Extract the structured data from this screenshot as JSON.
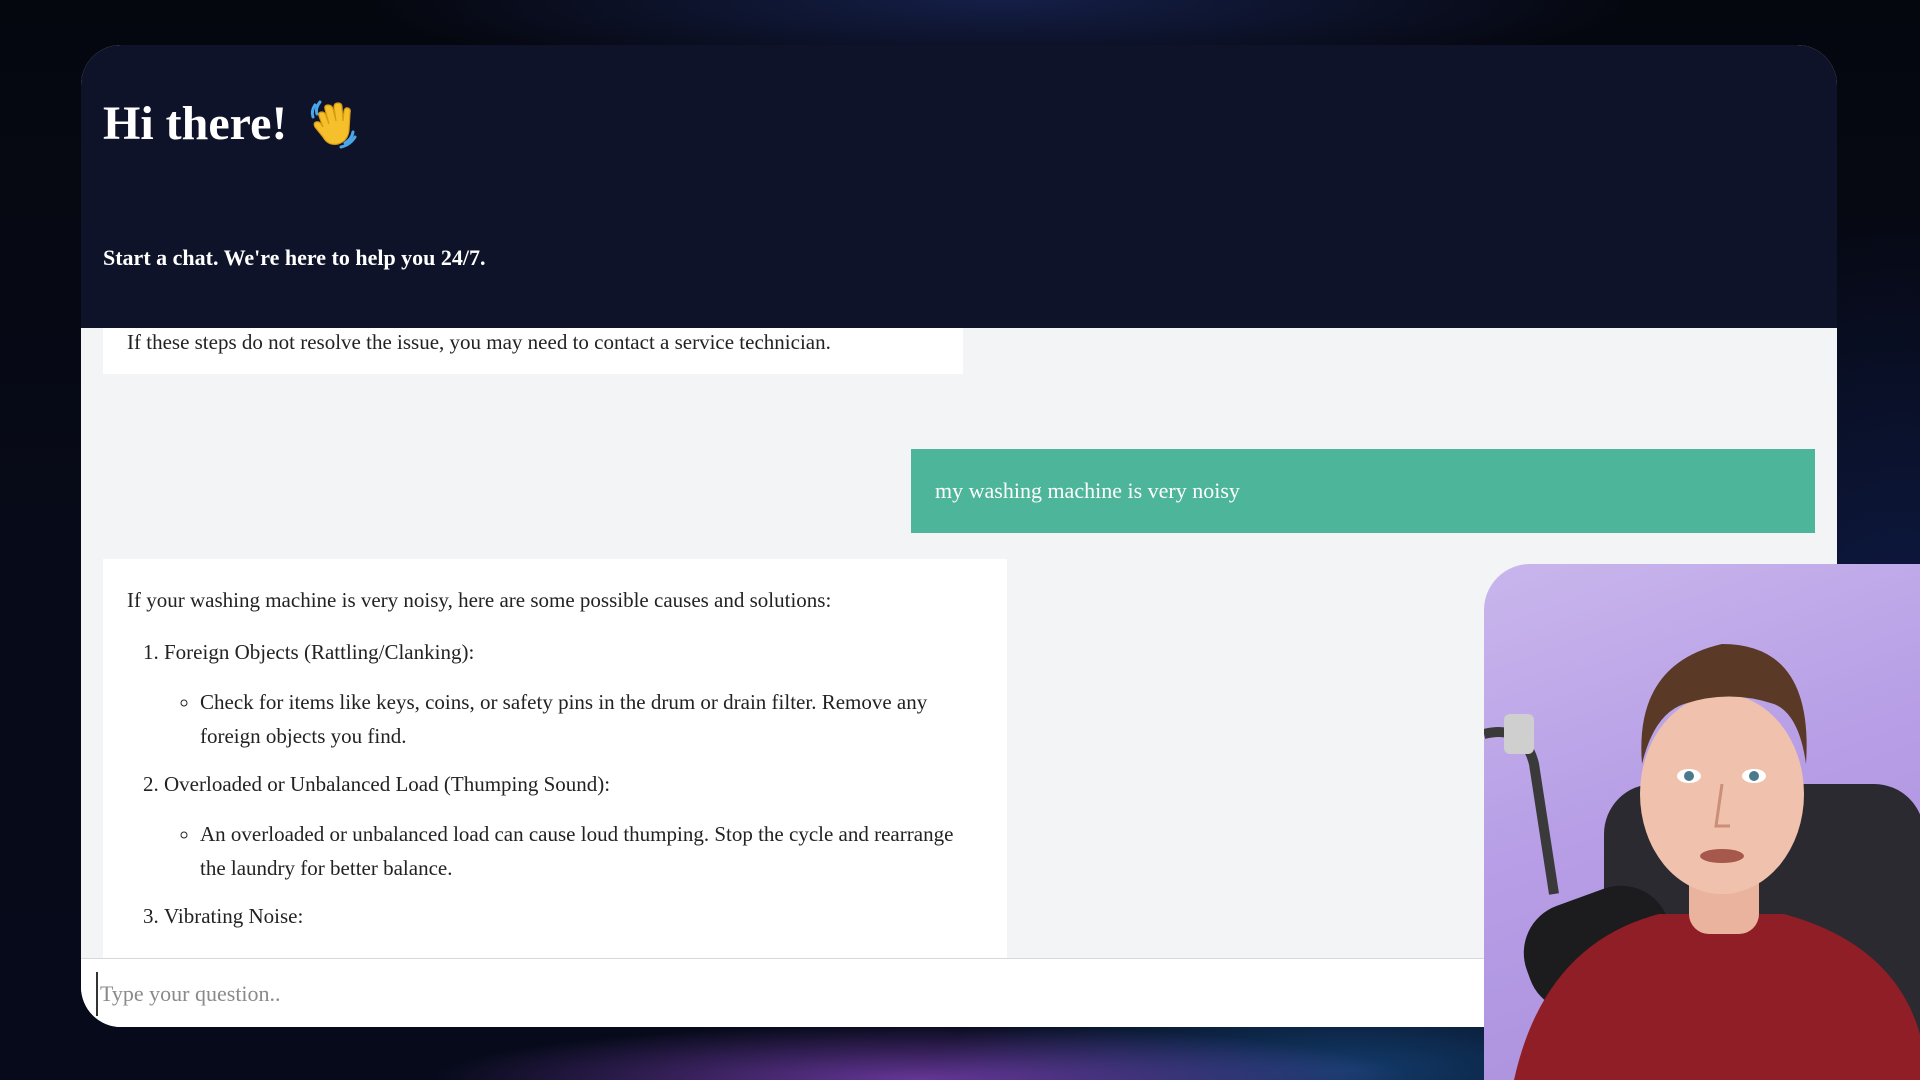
{
  "header": {
    "title": "Hi there!",
    "subtitle": "Start a chat. We're here to help you 24/7."
  },
  "messages": {
    "previous_bot_tail": "If these steps do not resolve the issue, you may need to contact a service technician.",
    "user_message": "my washing machine is very noisy",
    "bot_reply": {
      "intro": "If your washing machine is very noisy, here are some possible causes and solutions:",
      "items": [
        {
          "heading": "Foreign Objects (Rattling/Clanking):",
          "details": [
            "Check for items like keys, coins, or safety pins in the drum or drain filter. Remove any foreign objects you find."
          ]
        },
        {
          "heading": "Overloaded or Unbalanced Load (Thumping Sound):",
          "details": [
            "An overloaded or unbalanced load can cause loud thumping. Stop the cycle and rearrange the laundry for better balance."
          ]
        },
        {
          "heading": "Vibrating Noise:",
          "details": []
        }
      ]
    }
  },
  "input": {
    "placeholder": "Type your question.."
  },
  "colors": {
    "header_bg": "#0f1329",
    "user_bubble": "#4cb59a",
    "chat_bg": "#f3f4f6"
  },
  "icons": {
    "greeting": "waving-hand-icon",
    "pointer": "mouse-cursor-icon"
  }
}
